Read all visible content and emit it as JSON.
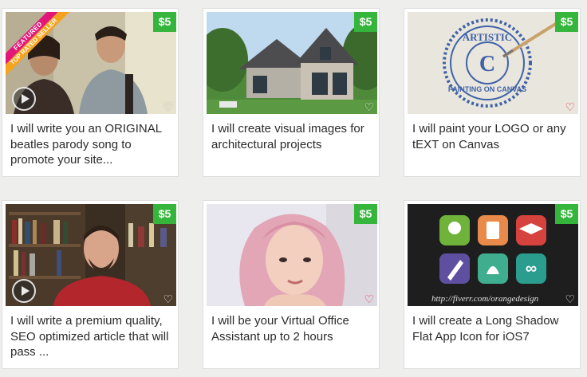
{
  "gigs": [
    {
      "title": "I will write you an ORIGINAL beatles parody song to promote your site...",
      "price": "$5",
      "featured_label": "FEATURED",
      "badge_label": "TOP RATED SELLER"
    },
    {
      "title": "I will create visual images for architectural projects",
      "price": "$5"
    },
    {
      "title": "I will paint your LOGO or any tEXT on Canvas",
      "price": "$5",
      "stamp_top": "ARTISTIC",
      "stamp_bottom": "PAINTING ON CANVAS",
      "stamp_letter": "C"
    },
    {
      "title": "I will write a premium quality, SEO optimized article that will pass ...",
      "price": "$5"
    },
    {
      "title": "I will be your Virtual Office Assistant up to 2 hours",
      "price": "$5"
    },
    {
      "title": "I will create a Long Shadow Flat App Icon for iOS7",
      "price": "$5",
      "watermark": "http://fiverr.com/orangedesign"
    }
  ],
  "icons": {
    "heart": "heart-icon",
    "play": "play-icon"
  },
  "colors": {
    "price_badge": "#36b53c",
    "featured": "#e3177a",
    "top_rated": "#f6a21c"
  }
}
